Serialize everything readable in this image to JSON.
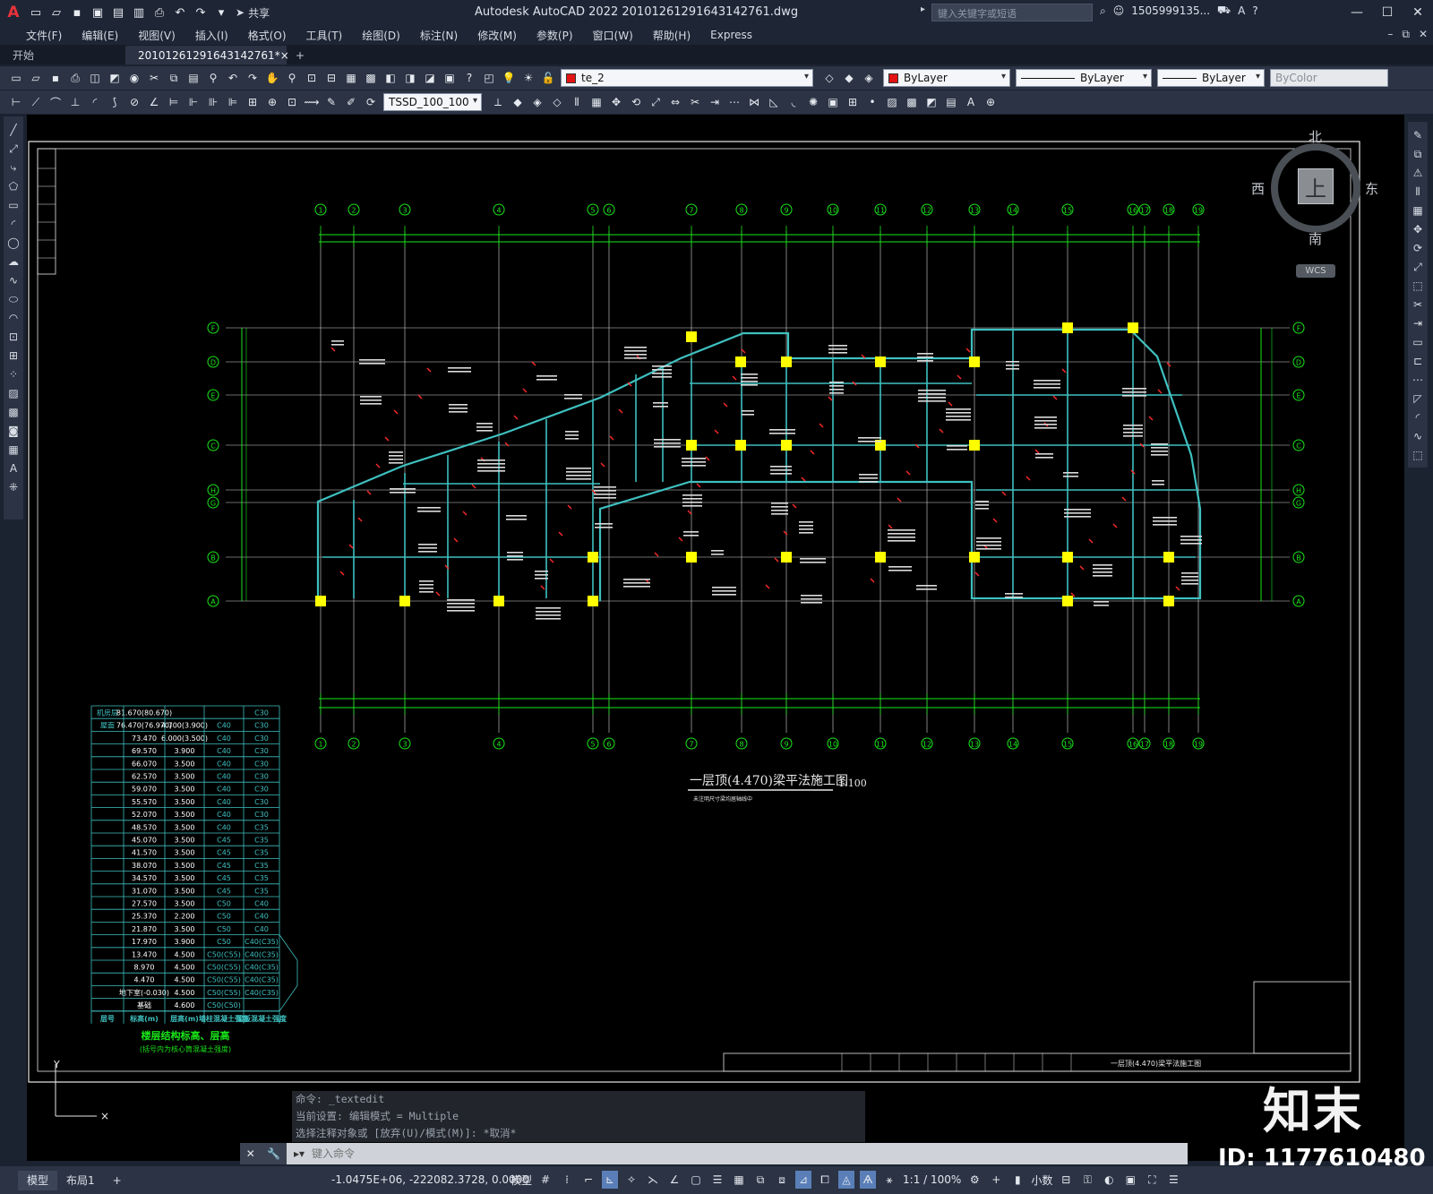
{
  "app": {
    "title": "Autodesk AutoCAD 2022    20101261291643142761.dwg",
    "logo": "A",
    "share_label": "共享",
    "search_placeholder": "键入关键字或短语",
    "user": "1505999135...",
    "help": "?"
  },
  "menu": [
    "文件(F)",
    "编辑(E)",
    "视图(V)",
    "插入(I)",
    "格式(O)",
    "工具(T)",
    "绘图(D)",
    "标注(N)",
    "修改(M)",
    "参数(P)",
    "窗口(W)",
    "帮助(H)",
    "Express"
  ],
  "tabs": {
    "start": "开始",
    "active": "20101261291643142761*",
    "close": "×",
    "add": "+"
  },
  "toolbar": {
    "layer_value": "te_2",
    "color_value": "ByLayer",
    "linetype_value": "ByLayer",
    "lineweight_value": "ByLayer",
    "plotstyle_value": "ByColor",
    "dimstyle_value": "TSSD_100_100",
    "layer_swatch": "#e21414"
  },
  "viewcube": {
    "north": "北",
    "south": "南",
    "west": "西",
    "east": "东",
    "face": "上",
    "wcs": "WCS"
  },
  "drawing": {
    "plan_title": "一层顶(4.470)梁平法施工图",
    "plan_scale": "1:100",
    "plan_note": "未注明尺寸梁均居轴线中",
    "column_numbers_top": [
      "1",
      "2",
      "3",
      "4",
      "5",
      "6",
      "7",
      "8",
      "9",
      "10",
      "11",
      "12",
      "13",
      "14",
      "15",
      "16",
      "17",
      "18",
      "19"
    ],
    "column_numbers_bottom": [
      "1",
      "2",
      "3",
      "4",
      "5",
      "6",
      "7",
      "8",
      "9",
      "10",
      "11",
      "12",
      "13",
      "14"
    ],
    "row_labels": [
      "F",
      "D",
      "E",
      "C",
      "H",
      "G",
      "B",
      "A"
    ],
    "table_title": "楼层结构标高、层高",
    "table_subtitle": "(括号内为核心筒混凝土强度)",
    "table_footer": [
      "层号",
      "标高(m)",
      "层高(m)",
      "墙柱混凝土强度",
      "梁板混凝土强度"
    ],
    "table_rows": [
      [
        "机房层",
        "81.670(80.670)",
        "",
        "",
        "C30"
      ],
      [
        "屋面",
        "76.470(76.970)",
        "4.700(3.900)",
        "C40",
        "C30"
      ],
      [
        "",
        "73.470",
        "6.000(3.500)",
        "C40",
        "C30"
      ],
      [
        "",
        "69.570",
        "3.900",
        "C40",
        "C30"
      ],
      [
        "",
        "66.070",
        "3.500",
        "C40",
        "C30"
      ],
      [
        "",
        "62.570",
        "3.500",
        "C40",
        "C30"
      ],
      [
        "",
        "59.070",
        "3.500",
        "C40",
        "C30"
      ],
      [
        "",
        "55.570",
        "3.500",
        "C40",
        "C30"
      ],
      [
        "",
        "52.070",
        "3.500",
        "C40",
        "C30"
      ],
      [
        "",
        "48.570",
        "3.500",
        "C40",
        "C35"
      ],
      [
        "",
        "45.070",
        "3.500",
        "C45",
        "C35"
      ],
      [
        "",
        "41.570",
        "3.500",
        "C45",
        "C35"
      ],
      [
        "",
        "38.070",
        "3.500",
        "C45",
        "C35"
      ],
      [
        "",
        "34.570",
        "3.500",
        "C45",
        "C35"
      ],
      [
        "",
        "31.070",
        "3.500",
        "C45",
        "C35"
      ],
      [
        "",
        "27.570",
        "3.500",
        "C50",
        "C40"
      ],
      [
        "",
        "25.370",
        "2.200",
        "C50",
        "C40"
      ],
      [
        "",
        "21.870",
        "3.500",
        "C50",
        "C40"
      ],
      [
        "",
        "17.970",
        "3.900",
        "C50",
        "C40(C35)"
      ],
      [
        "",
        "13.470",
        "4.500",
        "C50(C55)",
        "C40(C35)"
      ],
      [
        "",
        "8.970",
        "4.500",
        "C50(C55)",
        "C40(C35)"
      ],
      [
        "",
        "4.470",
        "4.500",
        "C50(C55)",
        "C40(C35)"
      ],
      [
        "",
        "地下室(-0.030)",
        "4.500",
        "C50(C55)",
        "C40(C35)"
      ],
      [
        "",
        "基础",
        "4.600",
        "C50(C50)",
        ""
      ]
    ],
    "title_block_name": "一层顶(4.470)梁平法施工图"
  },
  "command": {
    "history": [
      "命令: _textedit",
      "当前设置: 编辑模式 = Multiple",
      "选择注释对象或 [放弃(U)/模式(M)]: *取消*"
    ],
    "placeholder": "键入命令"
  },
  "status": {
    "model_tab": "模型",
    "layout_tab": "布局1",
    "add_tab": "+",
    "coords": "-1.0475E+06, -222082.3728, 0.0000",
    "model_label": "模型",
    "scale": "1:1 / 100%",
    "units": "小数"
  },
  "watermark": {
    "brand": "知末",
    "id": "ID: 1177610480"
  }
}
